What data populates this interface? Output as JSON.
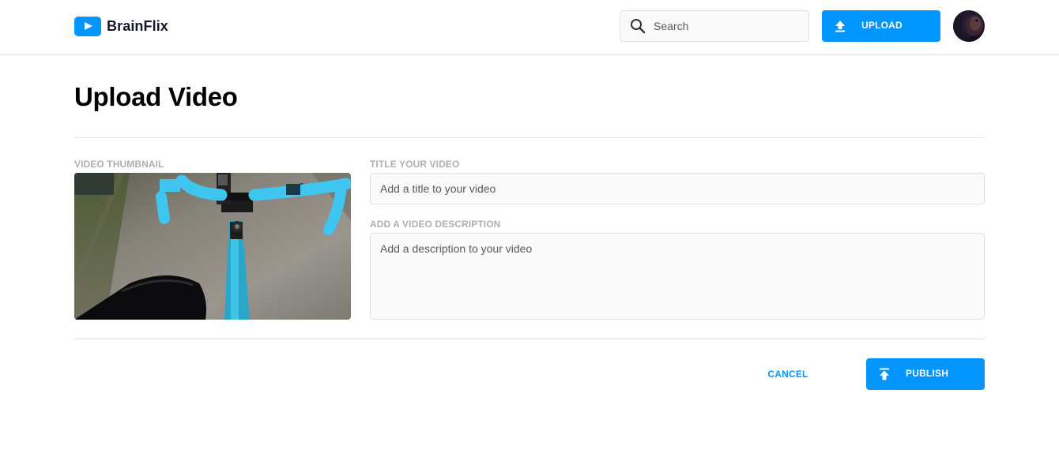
{
  "header": {
    "brand": "BrainFlix",
    "search": {
      "placeholder": "Search",
      "value": "",
      "icon": "search-icon"
    },
    "upload_button": {
      "label": "UPLOAD",
      "icon": "upload-icon"
    },
    "avatar": {
      "icon": "avatar"
    }
  },
  "main": {
    "title": "Upload Video",
    "thumbnail": {
      "label": "VIDEO THUMBNAIL"
    },
    "title_field": {
      "label": "TITLE YOUR VIDEO",
      "placeholder": "Add a title to your video",
      "value": ""
    },
    "description_field": {
      "label": "ADD A VIDEO DESCRIPTION",
      "placeholder": "Add a description to your video",
      "value": ""
    }
  },
  "actions": {
    "cancel_label": "CANCEL",
    "publish_label": "PUBLISH",
    "publish_icon": "publish-icon"
  },
  "colors": {
    "accent": "#0095ff",
    "label_gray": "#afafaf",
    "border": "#e1e1e1",
    "field_bg": "#fafafa"
  }
}
